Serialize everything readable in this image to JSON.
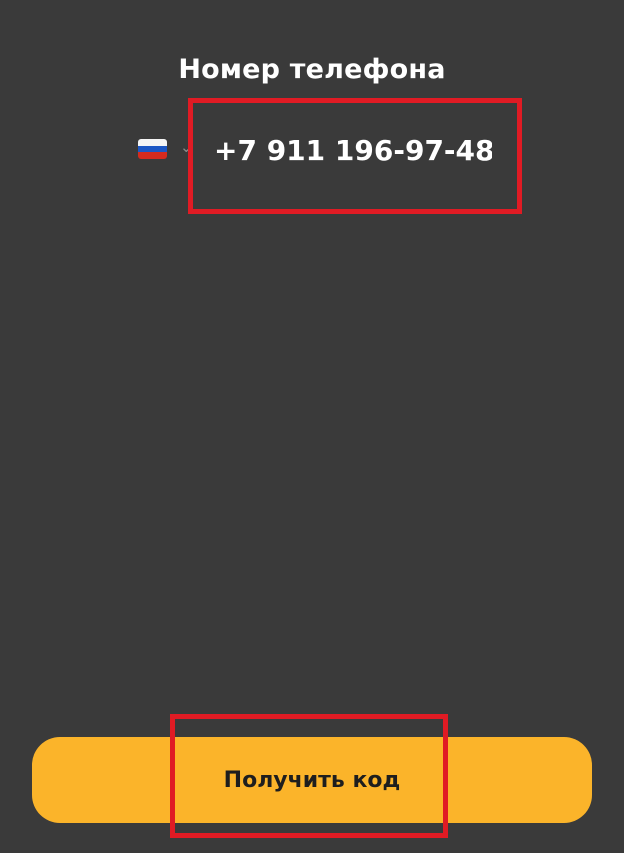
{
  "header": {
    "title": "Номер телефона"
  },
  "phone": {
    "country_flag": "russia-flag-icon",
    "value": "+7 911 196-97-48"
  },
  "actions": {
    "submit_label": "Получить код"
  },
  "colors": {
    "background": "#3a3a3a",
    "button": "#fbb42a",
    "highlight": "#e01b24"
  }
}
